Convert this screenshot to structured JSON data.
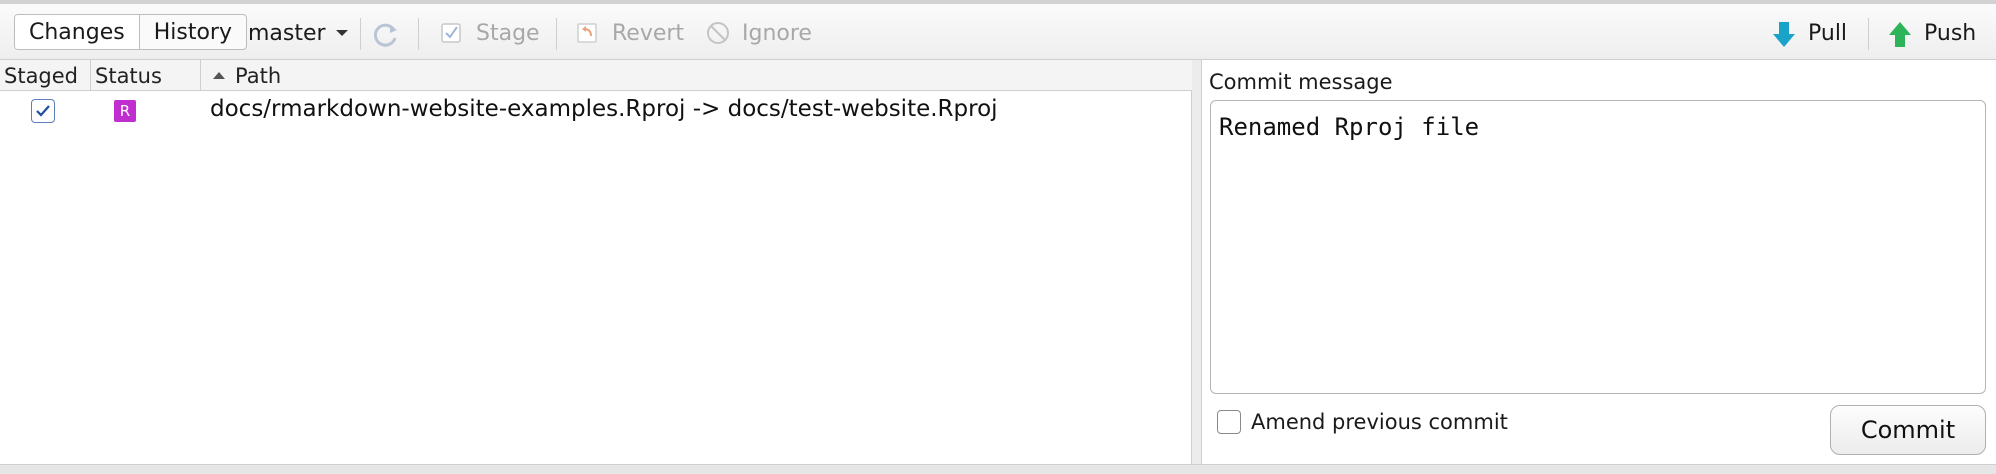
{
  "toolbar": {
    "changes_label": "Changes",
    "history_label": "History",
    "branch": "master",
    "stage_label": "Stage",
    "revert_label": "Revert",
    "ignore_label": "Ignore",
    "pull_label": "Pull",
    "push_label": "Push"
  },
  "grid": {
    "headers": {
      "staged": "Staged",
      "status": "Status",
      "path": "Path"
    },
    "rows": [
      {
        "staged": true,
        "status": "R",
        "path": "docs/rmarkdown-website-examples.Rproj -> docs/test-website.Rproj"
      }
    ]
  },
  "commit": {
    "label": "Commit message",
    "message": "Renamed Rproj file",
    "amend_label": "Amend previous commit",
    "amend_checked": false,
    "button_label": "Commit"
  },
  "icons": {
    "refresh": "refresh-icon",
    "stage": "stage-check-icon",
    "revert": "revert-icon",
    "ignore": "ignore-icon",
    "pull": "pull-arrow-down-icon",
    "push": "push-arrow-up-icon"
  },
  "colors": {
    "status_renamed": "#c12ecf",
    "pull_arrow": "#1aa3c9",
    "push_arrow": "#2db35a",
    "disabled_text": "#a8a8a8"
  }
}
